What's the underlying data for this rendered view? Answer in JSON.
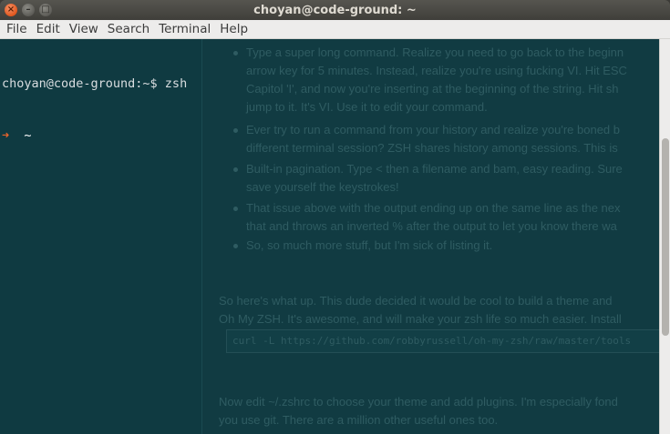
{
  "window": {
    "title": "choyan@code-ground: ~",
    "close_glyph": "×",
    "min_glyph": "–",
    "max_glyph": "□"
  },
  "menubar": {
    "items": [
      "File",
      "Edit",
      "View",
      "Search",
      "Terminal",
      "Help"
    ]
  },
  "terminal": {
    "prompt_line": "choyan@code-ground:~$ zsh",
    "zsh_arrow": "➜",
    "zsh_dir": "~"
  },
  "background_page": {
    "bullets": [
      "Type a super long command. Realize you need to go back to the beginn",
      "arrow key for 5 minutes. Instead, realize you're using fucking VI. Hit ESC",
      "Capitol 'I', and now you're inserting at the beginning of the string. Hit sh",
      "jump to it. It's VI. Use it to edit your command.",
      "Ever try to run a command from your history and realize you're boned b",
      "different terminal session? ZSH shares history among sessions. This is",
      "Built-in pagination. Type < then a filename and bam, easy reading. Sure",
      "save yourself the keystrokes!",
      "That issue above with the output ending up on the same line as the nex",
      "that and throws an inverted % after the output to let you know there wa",
      "So, so much more stuff, but I'm sick of listing it."
    ],
    "para1_line1": "So here's what up. This dude decided it would be cool to build a theme and",
    "para1_line2": "Oh My ZSH. It's awesome, and will make your zsh life so much easier. Install",
    "code": "curl -L https://github.com/robbyrussell/oh-my-zsh/raw/master/tools",
    "para2_line1": "Now edit ~/.zshrc to choose your theme and add plugins. I'm especially fond",
    "para2_line2": "you use git. There are a million other useful ones too."
  },
  "scrollbar": {
    "position_fraction": 0.5,
    "visible_fraction": 0.5
  }
}
